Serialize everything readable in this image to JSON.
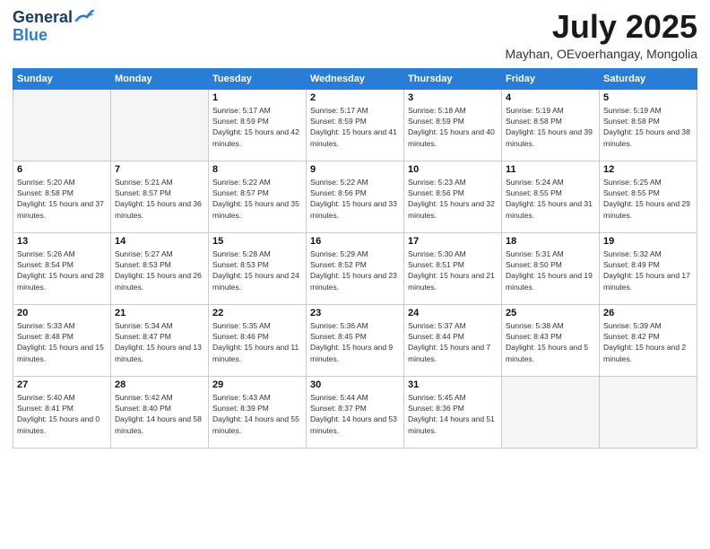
{
  "header": {
    "logo_line1": "General",
    "logo_line2": "Blue",
    "month": "July 2025",
    "location": "Mayhan, OEvoerhangay, Mongolia"
  },
  "weekdays": [
    "Sunday",
    "Monday",
    "Tuesday",
    "Wednesday",
    "Thursday",
    "Friday",
    "Saturday"
  ],
  "weeks": [
    [
      {
        "day": "",
        "sunrise": "",
        "sunset": "",
        "daylight": ""
      },
      {
        "day": "",
        "sunrise": "",
        "sunset": "",
        "daylight": ""
      },
      {
        "day": "1",
        "sunrise": "Sunrise: 5:17 AM",
        "sunset": "Sunset: 8:59 PM",
        "daylight": "Daylight: 15 hours and 42 minutes."
      },
      {
        "day": "2",
        "sunrise": "Sunrise: 5:17 AM",
        "sunset": "Sunset: 8:59 PM",
        "daylight": "Daylight: 15 hours and 41 minutes."
      },
      {
        "day": "3",
        "sunrise": "Sunrise: 5:18 AM",
        "sunset": "Sunset: 8:59 PM",
        "daylight": "Daylight: 15 hours and 40 minutes."
      },
      {
        "day": "4",
        "sunrise": "Sunrise: 5:19 AM",
        "sunset": "Sunset: 8:58 PM",
        "daylight": "Daylight: 15 hours and 39 minutes."
      },
      {
        "day": "5",
        "sunrise": "Sunrise: 5:19 AM",
        "sunset": "Sunset: 8:58 PM",
        "daylight": "Daylight: 15 hours and 38 minutes."
      }
    ],
    [
      {
        "day": "6",
        "sunrise": "Sunrise: 5:20 AM",
        "sunset": "Sunset: 8:58 PM",
        "daylight": "Daylight: 15 hours and 37 minutes."
      },
      {
        "day": "7",
        "sunrise": "Sunrise: 5:21 AM",
        "sunset": "Sunset: 8:57 PM",
        "daylight": "Daylight: 15 hours and 36 minutes."
      },
      {
        "day": "8",
        "sunrise": "Sunrise: 5:22 AM",
        "sunset": "Sunset: 8:57 PM",
        "daylight": "Daylight: 15 hours and 35 minutes."
      },
      {
        "day": "9",
        "sunrise": "Sunrise: 5:22 AM",
        "sunset": "Sunset: 8:56 PM",
        "daylight": "Daylight: 15 hours and 33 minutes."
      },
      {
        "day": "10",
        "sunrise": "Sunrise: 5:23 AM",
        "sunset": "Sunset: 8:56 PM",
        "daylight": "Daylight: 15 hours and 32 minutes."
      },
      {
        "day": "11",
        "sunrise": "Sunrise: 5:24 AM",
        "sunset": "Sunset: 8:55 PM",
        "daylight": "Daylight: 15 hours and 31 minutes."
      },
      {
        "day": "12",
        "sunrise": "Sunrise: 5:25 AM",
        "sunset": "Sunset: 8:55 PM",
        "daylight": "Daylight: 15 hours and 29 minutes."
      }
    ],
    [
      {
        "day": "13",
        "sunrise": "Sunrise: 5:26 AM",
        "sunset": "Sunset: 8:54 PM",
        "daylight": "Daylight: 15 hours and 28 minutes."
      },
      {
        "day": "14",
        "sunrise": "Sunrise: 5:27 AM",
        "sunset": "Sunset: 8:53 PM",
        "daylight": "Daylight: 15 hours and 26 minutes."
      },
      {
        "day": "15",
        "sunrise": "Sunrise: 5:28 AM",
        "sunset": "Sunset: 8:53 PM",
        "daylight": "Daylight: 15 hours and 24 minutes."
      },
      {
        "day": "16",
        "sunrise": "Sunrise: 5:29 AM",
        "sunset": "Sunset: 8:52 PM",
        "daylight": "Daylight: 15 hours and 23 minutes."
      },
      {
        "day": "17",
        "sunrise": "Sunrise: 5:30 AM",
        "sunset": "Sunset: 8:51 PM",
        "daylight": "Daylight: 15 hours and 21 minutes."
      },
      {
        "day": "18",
        "sunrise": "Sunrise: 5:31 AM",
        "sunset": "Sunset: 8:50 PM",
        "daylight": "Daylight: 15 hours and 19 minutes."
      },
      {
        "day": "19",
        "sunrise": "Sunrise: 5:32 AM",
        "sunset": "Sunset: 8:49 PM",
        "daylight": "Daylight: 15 hours and 17 minutes."
      }
    ],
    [
      {
        "day": "20",
        "sunrise": "Sunrise: 5:33 AM",
        "sunset": "Sunset: 8:48 PM",
        "daylight": "Daylight: 15 hours and 15 minutes."
      },
      {
        "day": "21",
        "sunrise": "Sunrise: 5:34 AM",
        "sunset": "Sunset: 8:47 PM",
        "daylight": "Daylight: 15 hours and 13 minutes."
      },
      {
        "day": "22",
        "sunrise": "Sunrise: 5:35 AM",
        "sunset": "Sunset: 8:46 PM",
        "daylight": "Daylight: 15 hours and 11 minutes."
      },
      {
        "day": "23",
        "sunrise": "Sunrise: 5:36 AM",
        "sunset": "Sunset: 8:45 PM",
        "daylight": "Daylight: 15 hours and 9 minutes."
      },
      {
        "day": "24",
        "sunrise": "Sunrise: 5:37 AM",
        "sunset": "Sunset: 8:44 PM",
        "daylight": "Daylight: 15 hours and 7 minutes."
      },
      {
        "day": "25",
        "sunrise": "Sunrise: 5:38 AM",
        "sunset": "Sunset: 8:43 PM",
        "daylight": "Daylight: 15 hours and 5 minutes."
      },
      {
        "day": "26",
        "sunrise": "Sunrise: 5:39 AM",
        "sunset": "Sunset: 8:42 PM",
        "daylight": "Daylight: 15 hours and 2 minutes."
      }
    ],
    [
      {
        "day": "27",
        "sunrise": "Sunrise: 5:40 AM",
        "sunset": "Sunset: 8:41 PM",
        "daylight": "Daylight: 15 hours and 0 minutes."
      },
      {
        "day": "28",
        "sunrise": "Sunrise: 5:42 AM",
        "sunset": "Sunset: 8:40 PM",
        "daylight": "Daylight: 14 hours and 58 minutes."
      },
      {
        "day": "29",
        "sunrise": "Sunrise: 5:43 AM",
        "sunset": "Sunset: 8:39 PM",
        "daylight": "Daylight: 14 hours and 55 minutes."
      },
      {
        "day": "30",
        "sunrise": "Sunrise: 5:44 AM",
        "sunset": "Sunset: 8:37 PM",
        "daylight": "Daylight: 14 hours and 53 minutes."
      },
      {
        "day": "31",
        "sunrise": "Sunrise: 5:45 AM",
        "sunset": "Sunset: 8:36 PM",
        "daylight": "Daylight: 14 hours and 51 minutes."
      },
      {
        "day": "",
        "sunrise": "",
        "sunset": "",
        "daylight": ""
      },
      {
        "day": "",
        "sunrise": "",
        "sunset": "",
        "daylight": ""
      }
    ]
  ]
}
